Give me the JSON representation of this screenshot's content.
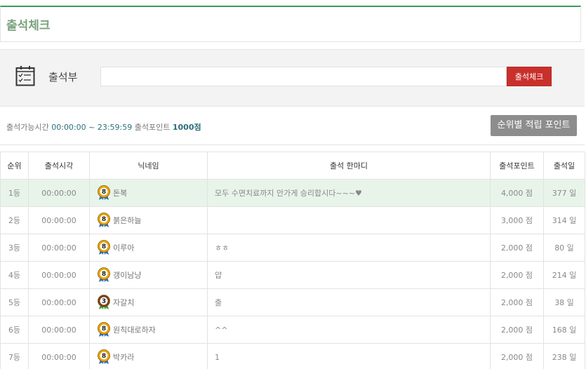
{
  "page": {
    "title": "출석체크"
  },
  "book": {
    "label": "출석부",
    "input_value": "",
    "check_button": "출석체크"
  },
  "info": {
    "prefix": "출석가능시간",
    "time_range": "00:00:00 ~ 23:59:59",
    "point_label": "출석포인트",
    "point_value": "1000점",
    "rank_button": "순위별 적립 포인트"
  },
  "table": {
    "headers": [
      "순위",
      "출석시각",
      "닉네임",
      "출석 한마디",
      "출석포인트",
      "출석일"
    ],
    "rows": [
      {
        "rank": "1등",
        "time": "00:00:00",
        "level": "8",
        "nick": "돈복",
        "message": "모두 수면치료까지 안가게 승리합시다~~~♥",
        "points": "4,000 점",
        "days": "377 일"
      },
      {
        "rank": "2등",
        "time": "00:00:00",
        "level": "8",
        "nick": "붉은하늘",
        "message": "",
        "points": "3,000 점",
        "days": "314 일"
      },
      {
        "rank": "3등",
        "time": "00:00:00",
        "level": "8",
        "nick": "이루아",
        "message": "ㅎㅎ",
        "points": "2,000 점",
        "days": "80 일"
      },
      {
        "rank": "4등",
        "time": "00:00:00",
        "level": "8",
        "nick": "갱이남냥",
        "message": "얍",
        "points": "2,000 점",
        "days": "214 일"
      },
      {
        "rank": "5등",
        "time": "00:00:00",
        "level": "3",
        "nick": "자갈치",
        "message": "출",
        "points": "2,000 점",
        "days": "38 일"
      },
      {
        "rank": "6등",
        "time": "00:00:00",
        "level": "8",
        "nick": "원칙대로하자",
        "message": "^^",
        "points": "2,000 점",
        "days": "168 일"
      },
      {
        "rank": "7등",
        "time": "00:00:00",
        "level": "8",
        "nick": "박카라",
        "message": "1",
        "points": "2,000 점",
        "days": "238 일"
      }
    ]
  },
  "colors": {
    "accent": "#3c9a5f",
    "button_red": "#c9302c",
    "highlight_row": "#e8f4e9",
    "level8": "#e8a400",
    "level3": "#7b3b1f"
  }
}
